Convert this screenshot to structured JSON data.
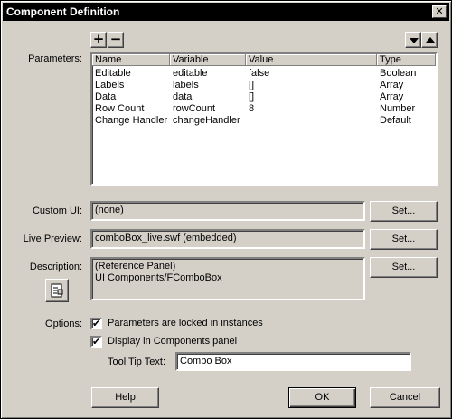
{
  "window": {
    "title": "Component Definition",
    "close_glyph": "✕"
  },
  "parameters": {
    "label": "Parameters:",
    "add_glyph": "+",
    "remove_glyph": "−",
    "columns": [
      "Name",
      "Variable",
      "Value",
      "Type"
    ],
    "rows": [
      [
        "Editable",
        "editable",
        "false",
        "Boolean"
      ],
      [
        "Labels",
        "labels",
        "[]",
        "Array"
      ],
      [
        "Data",
        "data",
        "[]",
        "Array"
      ],
      [
        "Row Count",
        "rowCount",
        "8",
        "Number"
      ],
      [
        "Change Handler",
        "changeHandler",
        "",
        "Default"
      ]
    ]
  },
  "custom_ui": {
    "label": "Custom UI:",
    "value": "(none)",
    "button": "Set..."
  },
  "live_preview": {
    "label": "Live Preview:",
    "value": "comboBox_live.swf (embedded)",
    "button": "Set..."
  },
  "description": {
    "label": "Description:",
    "line1": "(Reference Panel)",
    "line2": "UI Components/FComboBox",
    "button": "Set..."
  },
  "options": {
    "label": "Options:",
    "locked_label": "Parameters are locked in instances",
    "locked_checked": true,
    "display_label": "Display in Components panel",
    "display_checked": true,
    "tooltip_label": "Tool Tip Text:",
    "tooltip_value": "Combo Box",
    "check_glyph": "✔"
  },
  "footer": {
    "help": "Help",
    "ok": "OK",
    "cancel": "Cancel"
  }
}
